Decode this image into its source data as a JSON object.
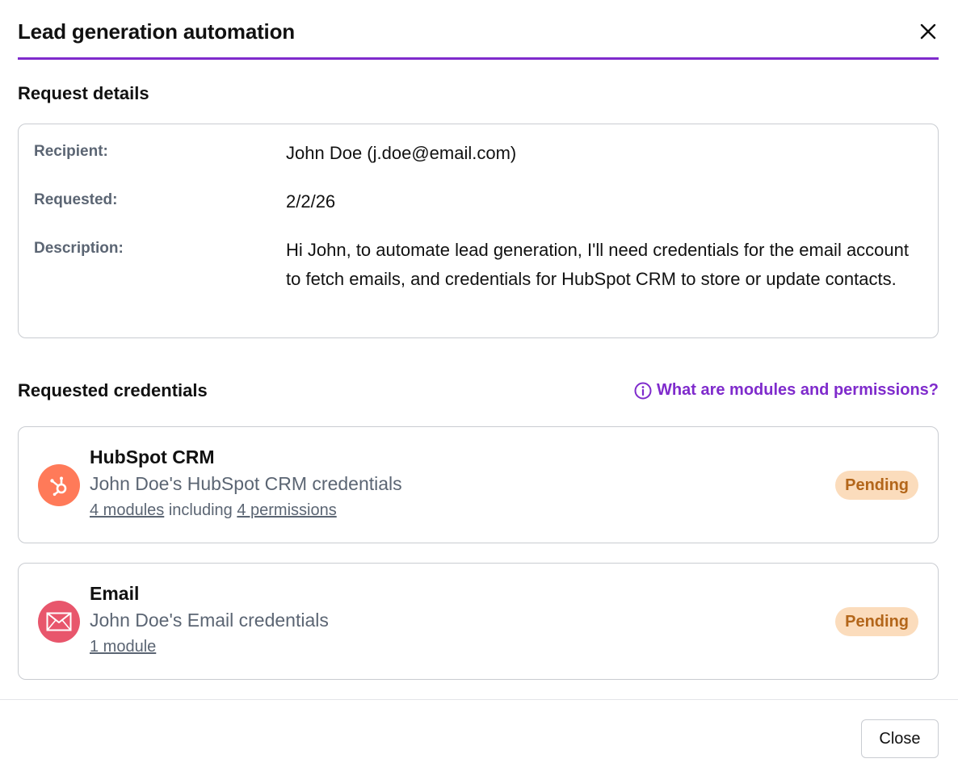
{
  "dialog": {
    "title": "Lead generation automation",
    "close_icon": "close-icon"
  },
  "request_details": {
    "heading": "Request details",
    "recipient_label": "Recipient:",
    "recipient_value": "John Doe (j.doe@email.com)",
    "requested_label": "Requested:",
    "requested_value": "2/2/26",
    "description_label": "Description:",
    "description_value": "Hi John, to automate lead generation, I'll need credentials for the email account to fetch emails, and credentials for HubSpot CRM to store or update contacts."
  },
  "credentials": {
    "heading": "Requested credentials",
    "help_link": "What are modules and permissions?",
    "help_icon": "info-icon",
    "items": [
      {
        "name": "HubSpot CRM",
        "subtitle": "John Doe's HubSpot CRM credentials",
        "modules_link": "4 modules",
        "including_text": " including ",
        "permissions_link": "4 permissions",
        "status": "Pending",
        "icon": "hubspot-icon",
        "icon_color": "#ff7a59"
      },
      {
        "name": "Email",
        "subtitle": "John Doe's Email credentials",
        "modules_link": "1 module",
        "status": "Pending",
        "icon": "envelope-icon",
        "icon_color": "#e8566c"
      }
    ]
  },
  "footer": {
    "close_label": "Close"
  },
  "colors": {
    "accent": "#7f2bcc",
    "badge_bg": "#fbdcbc",
    "badge_text": "#b3661a"
  }
}
